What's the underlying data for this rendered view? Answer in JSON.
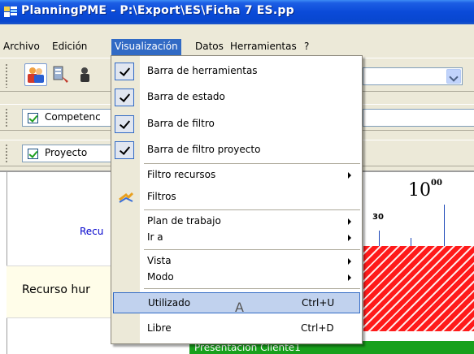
{
  "window": {
    "title": "PlanningPME - P:\\Export\\ES\\Ficha 7 ES.pp",
    "app_icon": "planning-app-icon"
  },
  "menubar": {
    "items": [
      {
        "label": "Archivo"
      },
      {
        "label": "Edición"
      },
      {
        "label": "Visualización"
      },
      {
        "label": "Datos"
      },
      {
        "label": "Herramientas"
      },
      {
        "label": "?"
      }
    ]
  },
  "toolbar": {
    "filter_competence": "Competenc",
    "filter_project": "Proyecto"
  },
  "view_menu": {
    "items": [
      {
        "label": "Barra de herramientas",
        "checked": true
      },
      {
        "label": "Barra de estado",
        "checked": true
      },
      {
        "label": "Barra de filtro",
        "checked": true
      },
      {
        "label": "Barra de filtro proyecto",
        "checked": true
      },
      {
        "label": "Filtro recursos",
        "submenu": true
      },
      {
        "label": "Filtros",
        "icon": "filter-icon"
      },
      {
        "label": "Plan de trabajo",
        "submenu": true
      },
      {
        "label": "Ir a",
        "submenu": true
      },
      {
        "label": "Vista",
        "submenu": true
      },
      {
        "label": "Modo",
        "submenu": true
      },
      {
        "label": "Utilizado",
        "shortcut": "Ctrl+U",
        "highlighted": true
      },
      {
        "label": "Libre",
        "shortcut": "Ctrl+D"
      }
    ],
    "cursor_char": "A"
  },
  "planning": {
    "resources_header": "Recu",
    "row_label": "Recurso hur",
    "time_hour": "10",
    "time_hour_sup": "00",
    "time_minute": "30",
    "task_label": "Presentación Cliente1"
  },
  "colors": {
    "accent": "#316ac5",
    "task_green": "#18a01c",
    "busy_red": "#ff1a1a",
    "title_blue": "#0a4ad8"
  }
}
